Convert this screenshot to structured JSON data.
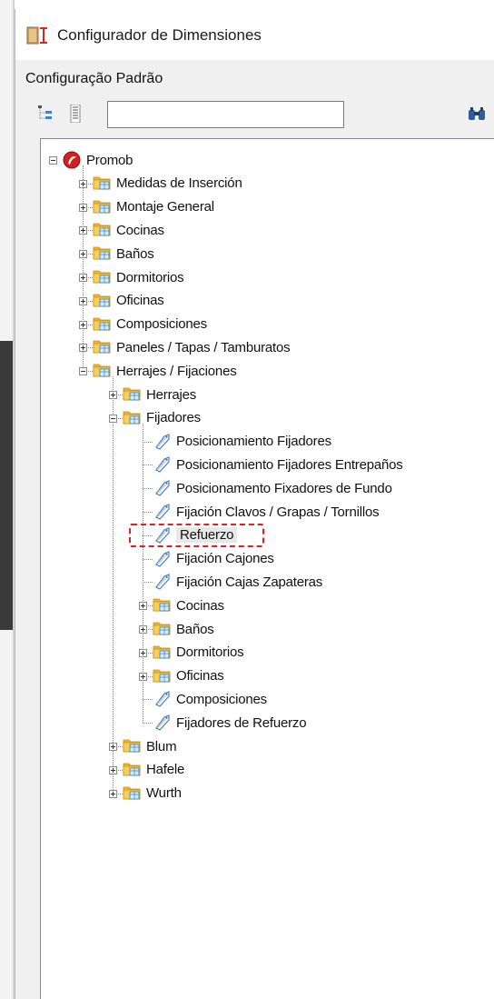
{
  "window": {
    "title": "Configurador de Dimensiones"
  },
  "header": {
    "subtitle": "Configuração Padrão"
  },
  "toolbar": {
    "search_value": "",
    "buttons": [
      "tree-collapse-icon",
      "tree-expand-icon",
      "binoculars-search-icon"
    ]
  },
  "tree": [
    {
      "label": "Promob",
      "depth": 0,
      "icon": "promob-logo-icon",
      "expander": "minus"
    },
    {
      "label": "Medidas de Inserción",
      "depth": 1,
      "icon": "folder-icon",
      "expander": "plus"
    },
    {
      "label": "Montaje General",
      "depth": 1,
      "icon": "folder-icon",
      "expander": "plus"
    },
    {
      "label": "Cocinas",
      "depth": 1,
      "icon": "folder-icon",
      "expander": "plus"
    },
    {
      "label": "Baños",
      "depth": 1,
      "icon": "folder-icon",
      "expander": "plus"
    },
    {
      "label": "Dormitorios",
      "depth": 1,
      "icon": "folder-icon",
      "expander": "plus"
    },
    {
      "label": "Oficinas",
      "depth": 1,
      "icon": "folder-icon",
      "expander": "plus"
    },
    {
      "label": "Composiciones",
      "depth": 1,
      "icon": "folder-icon",
      "expander": "plus"
    },
    {
      "label": "Paneles / Tapas / Tamburatos",
      "depth": 1,
      "icon": "folder-icon",
      "expander": "plus"
    },
    {
      "label": "Herrajes / Fijaciones",
      "depth": 1,
      "icon": "folder-icon",
      "expander": "minus"
    },
    {
      "label": "Herrajes",
      "depth": 2,
      "icon": "folder-icon",
      "expander": "plus"
    },
    {
      "label": "Fijadores",
      "depth": 2,
      "icon": "folder-icon",
      "expander": "minus"
    },
    {
      "label": "Posicionamiento Fijadores",
      "depth": 3,
      "icon": "config-tag-icon",
      "expander": "none"
    },
    {
      "label": "Posicionamiento Fijadores Entrepaños",
      "depth": 3,
      "icon": "config-tag-icon",
      "expander": "none"
    },
    {
      "label": "Posicionamento Fixadores de Fundo",
      "depth": 3,
      "icon": "config-tag-icon",
      "expander": "none"
    },
    {
      "label": "Fijación Clavos / Grapas / Tornillos",
      "depth": 3,
      "icon": "config-tag-icon",
      "expander": "none"
    },
    {
      "label": "Refuerzo",
      "depth": 3,
      "icon": "config-tag-icon",
      "expander": "none",
      "selected": true
    },
    {
      "label": "Fijación Cajones",
      "depth": 3,
      "icon": "config-tag-icon",
      "expander": "none"
    },
    {
      "label": "Fijación Cajas Zapateras",
      "depth": 3,
      "icon": "config-tag-icon",
      "expander": "none"
    },
    {
      "label": "Cocinas",
      "depth": 3,
      "icon": "folder-icon",
      "expander": "plus"
    },
    {
      "label": "Baños",
      "depth": 3,
      "icon": "folder-icon",
      "expander": "plus"
    },
    {
      "label": "Dormitorios",
      "depth": 3,
      "icon": "folder-icon",
      "expander": "plus"
    },
    {
      "label": "Oficinas",
      "depth": 3,
      "icon": "folder-icon",
      "expander": "plus"
    },
    {
      "label": "Composiciones",
      "depth": 3,
      "icon": "config-tag-icon",
      "expander": "none"
    },
    {
      "label": "Fijadores de Refuerzo",
      "depth": 3,
      "icon": "config-tag-icon",
      "expander": "none"
    },
    {
      "label": "Blum",
      "depth": 2,
      "icon": "folder-icon",
      "expander": "plus"
    },
    {
      "label": "Hafele",
      "depth": 2,
      "icon": "folder-icon",
      "expander": "plus"
    },
    {
      "label": "Wurth",
      "depth": 2,
      "icon": "folder-icon",
      "expander": "plus"
    }
  ],
  "colors": {
    "selection_outline": "#e02020",
    "folder": "#f0b429",
    "tag": "#4a7ebb"
  }
}
